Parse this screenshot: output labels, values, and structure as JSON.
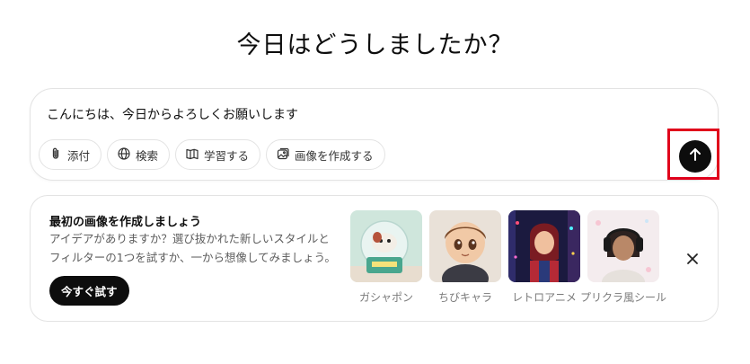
{
  "heading": "今日はどうしましたか？",
  "composer": {
    "text": "こんにちは、今日からよろしくお願いします",
    "tools": [
      {
        "icon": "paperclip-icon",
        "label": "添付"
      },
      {
        "icon": "globe-icon",
        "label": "検索"
      },
      {
        "icon": "book-icon",
        "label": "学習する"
      },
      {
        "icon": "image-icon",
        "label": "画像を作成する"
      }
    ],
    "send_icon": "arrow-up-icon"
  },
  "promo": {
    "title": "最初の画像を作成しましょう",
    "description": "アイデアがありますか？選び抜かれた新しいスタイルとフィルターの1つを試すか、一から想像してみましょう。",
    "button_label": "今すぐ試す",
    "styles": [
      {
        "label": "ガシャポン"
      },
      {
        "label": "ちびキャラ"
      },
      {
        "label": "レトロアニメ"
      },
      {
        "label": "プリクラ風シール"
      }
    ],
    "close_icon": "close-icon"
  },
  "colors": {
    "accent_highlight": "#e0001b",
    "button_dark": "#0d0d0d",
    "border": "#e3e3e3"
  }
}
